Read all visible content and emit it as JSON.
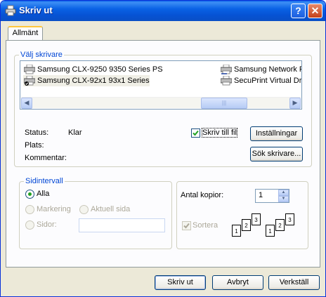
{
  "window": {
    "title": "Skriv ut",
    "help_label": "?",
    "close_label": "✕"
  },
  "tabs": [
    {
      "label": "Allmänt",
      "selected": true
    }
  ],
  "printer_group": {
    "legend": "Välj skrivare",
    "printers": [
      {
        "name": "Samsung CLX-9250 9350 Series PS",
        "icon": "printer-icon"
      },
      {
        "name": "Samsung CLX-92x1 93x1 Series",
        "icon": "printer-default-icon",
        "selected": true
      },
      {
        "name": "Samsung Network Pr",
        "icon": "network-printer-icon"
      },
      {
        "name": "SecuPrint Virtual Driv",
        "icon": "printer-icon"
      }
    ],
    "scroll_grip": "|||"
  },
  "status": {
    "status_label": "Status:",
    "status_value": "Klar",
    "location_label": "Plats:",
    "location_value": "",
    "comment_label": "Kommentar:",
    "comment_value": ""
  },
  "print_to_file": {
    "label": "Skriv till fil",
    "checked": true
  },
  "buttons": {
    "settings": "Inställningar",
    "find_printer": "Sök skrivare...",
    "print": "Skriv ut",
    "cancel": "Avbryt",
    "apply": "Verkställ"
  },
  "range_group": {
    "legend": "Sidintervall",
    "all": "Alla",
    "selection": "Markering",
    "current_page": "Aktuell sida",
    "pages": "Sidor:",
    "pages_value": ""
  },
  "copies": {
    "label": "Antal kopior:",
    "value": "1",
    "collate_label": "Sortera",
    "collate_checked": true
  },
  "collate_pages": [
    "1",
    "2",
    "3"
  ]
}
